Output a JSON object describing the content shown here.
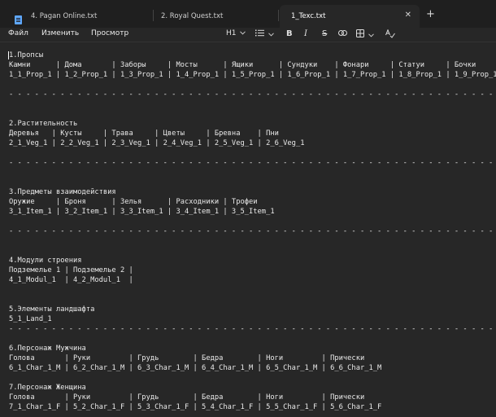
{
  "tabs": [
    {
      "label": "4. Pagan Online.txt",
      "active": false
    },
    {
      "label": "2. Royal Quest.txt",
      "active": false
    },
    {
      "label": "1_Texc.txt",
      "active": true
    }
  ],
  "tab_close_glyph": "✕",
  "new_tab_glyph": "+",
  "menu": [
    "Файл",
    "Изменить",
    "Просмотр"
  ],
  "toolbar": {
    "heading": "H1",
    "bold": "B",
    "italic": "I",
    "strike": "S"
  },
  "document": {
    "lines": [
      "1.Пропсы",
      "Камни      | Дома       | Заборы     | Мосты      | Ящики      | Сундуки    | Фонари     | Статуи     | Бочки",
      "1_1_Prop_1 | 1_2_Prop_1 | 1_3_Prop_1 | 1_4_Prop_1 | 1_5_Prop_1 | 1_6_Prop_1 | 1_7_Prop_1 | 1_8_Prop_1 | 1_9_Prop_1",
      "",
      "- - - - - - - - - - - - - - - - - - - - - - - - - - - - - - - - - - - - - - - - - - - - - - - - - - - - - - - - - - -",
      "",
      "",
      "2.Растительность",
      "Деревья   | Кусты     | Трава     | Цветы     | Бревна    | Пни",
      "2_1_Veg_1 | 2_2_Veg_1 | 2_3_Veg_1 | 2_4_Veg_1 | 2_5_Veg_1 | 2_6_Veg_1",
      "",
      "- - - - - - - - - - - - - - - - - - - - - - - - - - - - - - - - - - - - - - - - - - - - - - - - - - - - - - - - - - -",
      "",
      "",
      "3.Предметы взаимодействия",
      "Оружие     | Броня      | Зелья      | Расходники | Трофеи",
      "3_1_Item_1 | 3_2_Item_1 | 3_3_Item_1 | 3_4_Item_1 | 3_5_Item_1",
      "",
      "- - - - - - - - - - - - - - - - - - - - - - - - - - - - - - - - - - - - - - - - - - - - - - - - - - - - - - - - - - -",
      "",
      "",
      "4.Модули строения",
      "Подземелье 1 | Подземелье 2 |",
      "4_1_Modul_1  | 4_2_Modul_1  |",
      "",
      "",
      "5.Элементы ландшафта",
      "5_1_Land_1",
      "- - - - - - - - - - - - - - - - - - - - - - - - - - - - - - - - - - - - - - - - - - - - - - - - - - - - - - - - - - -",
      "",
      "6.Персонаж Мужчина",
      "Голова       | Руки         | Грудь        | Бедра        | Ноги         | Прически",
      "6_1_Char_1_M | 6_2_Char_1_M | 6_3_Char_1_M | 6_4_Char_1_M | 6_5_Char_1_M | 6_6_Char_1_M",
      "",
      "7.Персонаж Женщина",
      "Голова       | Руки         | Грудь        | Бедра        | Ноги         | Прически",
      "7_1_Char_1_F | 5_2_Char_1_F | 5_3_Char_1_F | 5_4_Char_1_F | 5_5_Char_1_F | 5_6_Char_1_F"
    ]
  }
}
